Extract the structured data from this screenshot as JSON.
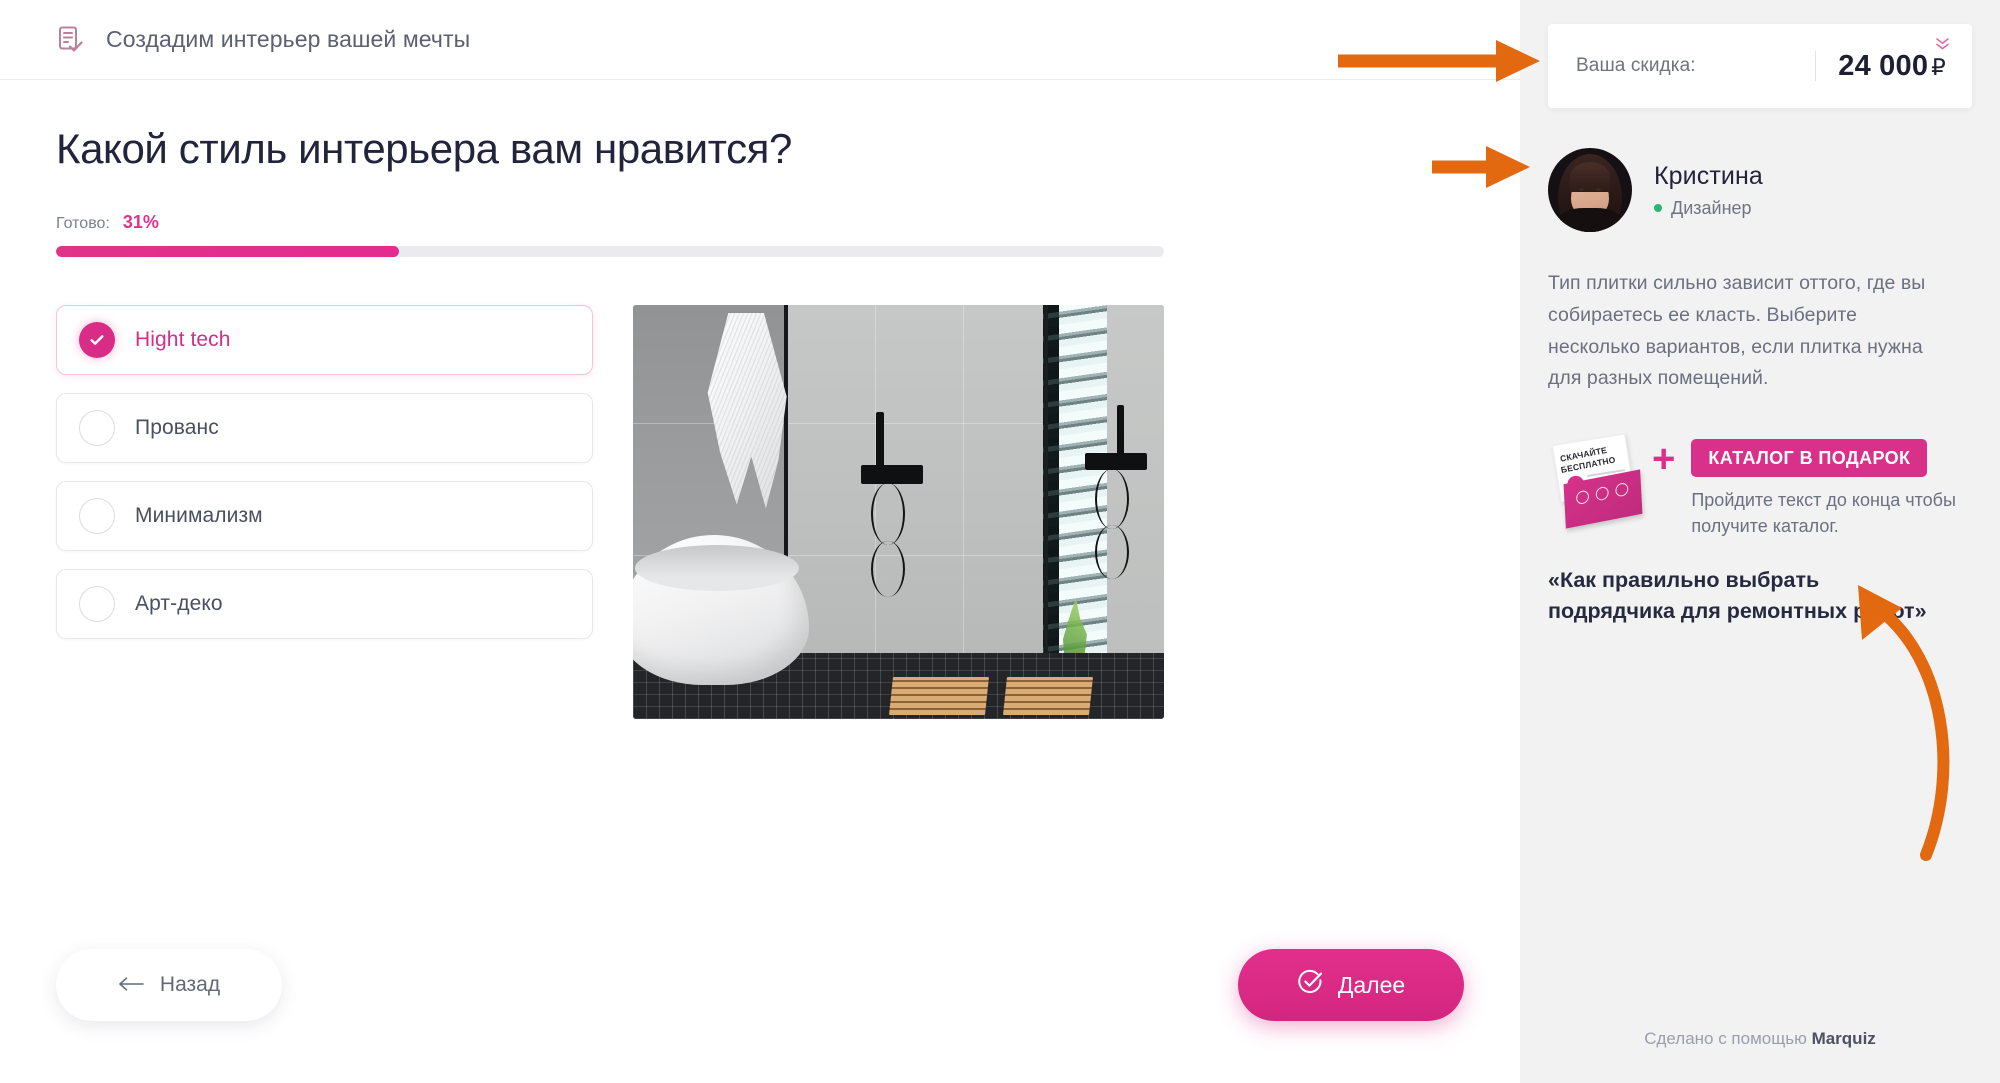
{
  "header": {
    "icon": "document-check-icon",
    "title": "Создадим интерьер вашей мечты"
  },
  "quiz": {
    "question": "Какой стиль интерьера вам нравится?",
    "progress_label": "Готово:",
    "progress_value": "31%",
    "progress_percent": 31,
    "options": [
      {
        "label": "Hight tech",
        "selected": true
      },
      {
        "label": "Прованс",
        "selected": false
      },
      {
        "label": "Минимализм",
        "selected": false
      },
      {
        "label": "Арт-деко",
        "selected": false
      }
    ],
    "image_alt": "Современная ванная комната в стиле хай-тек",
    "back_button": "Назад",
    "back_icon": "arrow-left-icon",
    "next_button": "Далее",
    "next_icon": "check-circle-icon"
  },
  "sidebar": {
    "discount": {
      "label": "Ваша скидка:",
      "value": "24 000",
      "currency": "₽",
      "chevrons_icon": "chevron-double-down-icon"
    },
    "person": {
      "name": "Кристина",
      "role": "Дизайнер",
      "status_icon": "online-dot-icon"
    },
    "message": "Тип плитки сильно зависит оттого, где вы собираетесь ее класть. Выберите несколько вариантов, если плитка нужна для разных помещений.",
    "promo": {
      "thumb_line1": "СКАЧАЙТЕ",
      "thumb_line2": "БЕСПЛАТНО",
      "thumb_icon": "download-icon",
      "plus_icon": "plus-icon",
      "badge": "КАТАЛОГ В ПОДАРОК",
      "subtitle": "Пройдите текст до конца чтобы получите каталог."
    },
    "quote": "«Как правильно выбрать подрядчика для ремонтных работ»",
    "footer_prefix": "Сделано с помощью ",
    "footer_brand": "Marquiz"
  },
  "colors": {
    "accent_pink": "#d9318a",
    "annotation_orange": "#e2690f",
    "sidebar_bg": "#f2f2f2",
    "title_dark": "#21243a",
    "online_green": "#2bb673"
  }
}
